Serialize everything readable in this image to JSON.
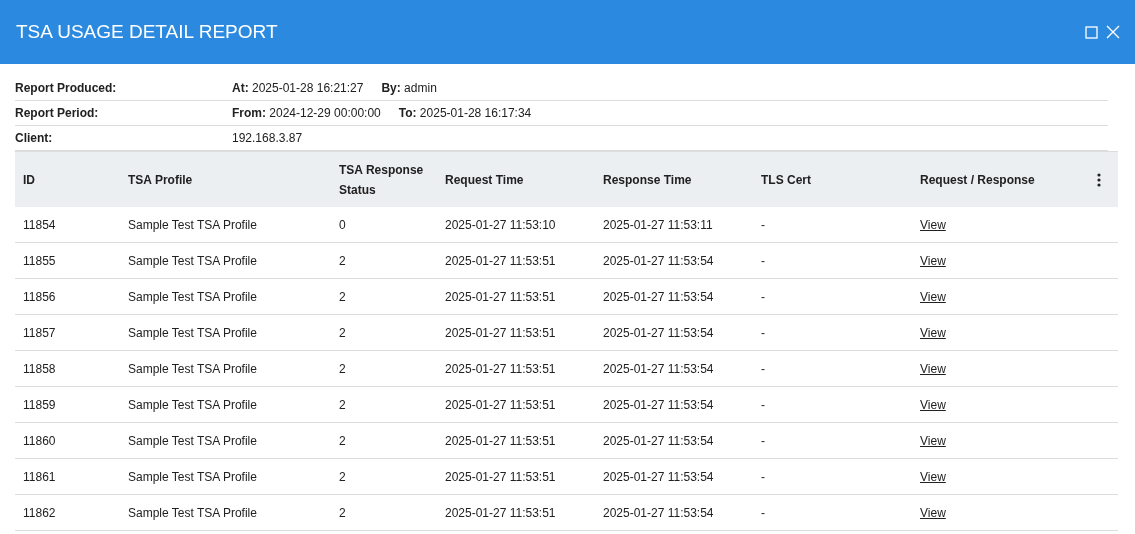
{
  "window": {
    "title": "TSA USAGE DETAIL REPORT"
  },
  "info": [
    {
      "label": "Report Produced:",
      "values": [
        "**At:** 2025-01-28 16:21:27",
        "**By:** admin"
      ]
    },
    {
      "label": "Report Period:",
      "values": [
        "**From:** 2024-12-29 00:00:00",
        "**To:** 2025-01-28 16:17:34"
      ]
    },
    {
      "label": "Client:",
      "values": [
        "192.168.3.87"
      ]
    }
  ],
  "table": {
    "columns": [
      "ID",
      "TSA Profile",
      "TSA Response Status",
      "Request Time",
      "Response Time",
      "TLS Cert",
      "Request / Response"
    ],
    "rows": [
      [
        "11854",
        "Sample Test TSA Profile",
        "0",
        "2025-01-27 11:53:10",
        "2025-01-27 11:53:11",
        "-",
        "View"
      ],
      [
        "11855",
        "Sample Test TSA Profile",
        "2",
        "2025-01-27 11:53:51",
        "2025-01-27 11:53:54",
        "-",
        "View"
      ],
      [
        "11856",
        "Sample Test TSA Profile",
        "2",
        "2025-01-27 11:53:51",
        "2025-01-27 11:53:54",
        "-",
        "View"
      ],
      [
        "11857",
        "Sample Test TSA Profile",
        "2",
        "2025-01-27 11:53:51",
        "2025-01-27 11:53:54",
        "-",
        "View"
      ],
      [
        "11858",
        "Sample Test TSA Profile",
        "2",
        "2025-01-27 11:53:51",
        "2025-01-27 11:53:54",
        "-",
        "View"
      ],
      [
        "11859",
        "Sample Test TSA Profile",
        "2",
        "2025-01-27 11:53:51",
        "2025-01-27 11:53:54",
        "-",
        "View"
      ],
      [
        "11860",
        "Sample Test TSA Profile",
        "2",
        "2025-01-27 11:53:51",
        "2025-01-27 11:53:54",
        "-",
        "View"
      ],
      [
        "11861",
        "Sample Test TSA Profile",
        "2",
        "2025-01-27 11:53:51",
        "2025-01-27 11:53:54",
        "-",
        "View"
      ],
      [
        "11862",
        "Sample Test TSA Profile",
        "2",
        "2025-01-27 11:53:51",
        "2025-01-27 11:53:54",
        "-",
        "View"
      ]
    ]
  }
}
